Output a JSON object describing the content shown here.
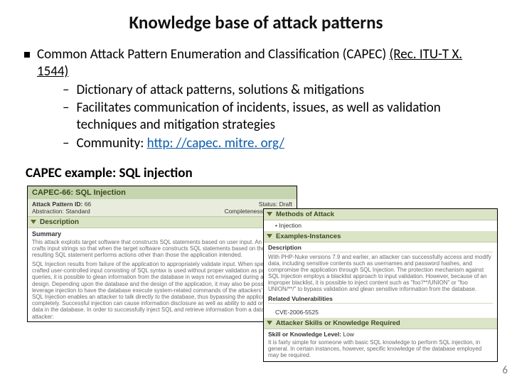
{
  "title": "Knowledge base of attack patterns",
  "bullet": {
    "main_lead": "Common Attack Pattern Enumeration and Classification (CAPEC) ",
    "main_ref": "(Rec. ITU-T X. 1544)",
    "sub1": "Dictionary of attack patterns, solutions & mitigations",
    "sub2": "Facilitates communication of incidents, issues, as well as validation techniques and mitigation strategies",
    "sub3_lead": "Community: ",
    "sub3_link": "http: //capec. mitre. org/"
  },
  "example_heading": "CAPEC example: SQL injection",
  "left": {
    "bar1": "CAPEC-66: SQL Injection",
    "id_label": "Attack Pattern ID:",
    "id_value": "66",
    "abstraction": "Abstraction: Standard",
    "status": "Status: Draft",
    "completeness": "Completeness: Complete",
    "desc_header": "Description",
    "summary_label": "Summary",
    "summary_p1": "This attack exploits target software that constructs SQL statements based on user input. An attacker crafts input strings so that when the target software constructs SQL statements based on the input, the resulting SQL statement performs actions other than those the application intended.",
    "summary_p2": "SQL Injection results from failure of the application to appropriately validate input. When specially crafted user-controlled input consisting of SQL syntax is used without proper validation as part of SQL queries, it is possible to glean information from the database in ways not envisaged during application design. Depending upon the database and the design of the application, it may also be possible to leverage injection to have the database execute system-related commands of the attackers' choice. SQL Injection enables an attacker to talk directly to the database, thus bypassing the application completely. Successful injection can cause information disclosure as well as ability to add or modify data in the database. In order to successfully inject SQL and retrieve information from a database, an attacker:"
  },
  "right": {
    "methods_header": "Methods of Attack",
    "methods_item": "Injection",
    "examples_header": "Examples-Instances",
    "desc_label": "Description",
    "desc_text": "With PHP-Nuke versions 7.9 and earlier, an attacker can successfully access and modify data, including sensitive contents such as usernames and password hashes, and compromise the application through SQL Injection. The protection mechanism against SQL Injection employs a blacklist approach to input validation. However, because of an improper blacklist, it is possible to inject content such as \"foo'/**/UNION\" or \"foo UNION/**/\" to bypass validation and glean sensitive information from the database.",
    "relvuln_label": "Related Vulnerabilities",
    "cve": "CVE-2006-5525",
    "skills_header": "Attacker Skills or Knowledge Required",
    "skill_label": "Skill or Knowledge Level:",
    "skill_value": "Low",
    "skill_text": "It is fairly simple for someone with basic SQL knowledge to perform SQL injection, in general. In certain instances, however, specific knowledge of the database employed may be required."
  },
  "page_number": "6"
}
